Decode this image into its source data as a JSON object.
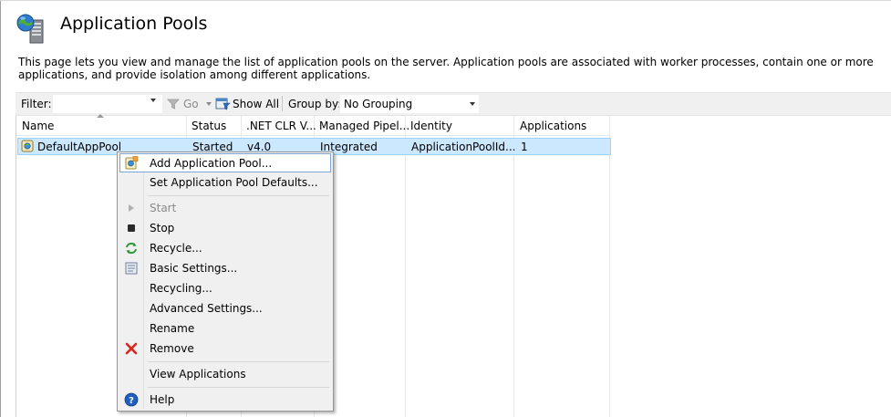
{
  "page": {
    "title": "Application Pools",
    "description": "This page lets you view and manage the list of application pools on the server. Application pools are associated with worker processes, contain one or more applications, and provide isolation among different applications."
  },
  "toolbar": {
    "filter_label": "Filter:",
    "filter_value": "",
    "go_label": "Go",
    "show_all_label": "Show All",
    "group_by_label": "Group by:",
    "group_by_value": "No Grouping"
  },
  "grid": {
    "columns": [
      "Name",
      "Status",
      ".NET CLR V...",
      "Managed Pipel...",
      "Identity",
      "Applications"
    ],
    "rows": [
      {
        "name": "DefaultAppPool",
        "status": "Started",
        "clr": "v4.0",
        "pipeline": "Integrated",
        "identity": "ApplicationPoolId...",
        "applications": "1"
      }
    ]
  },
  "context_menu": {
    "items": [
      {
        "label": "Add Application Pool...",
        "icon": "add-pool-icon",
        "highlighted": true
      },
      {
        "label": "Set Application Pool Defaults...",
        "icon": ""
      },
      {
        "label": "Start",
        "icon": "play-icon",
        "disabled": true
      },
      {
        "label": "Stop",
        "icon": "stop-icon"
      },
      {
        "label": "Recycle...",
        "icon": "recycle-icon"
      },
      {
        "label": "Basic Settings...",
        "icon": "settings-icon"
      },
      {
        "label": "Recycling...",
        "icon": ""
      },
      {
        "label": "Advanced Settings...",
        "icon": ""
      },
      {
        "label": "Rename",
        "icon": ""
      },
      {
        "label": "Remove",
        "icon": "remove-icon"
      },
      {
        "label": "View Applications",
        "icon": ""
      },
      {
        "label": "Help",
        "icon": "help-icon"
      }
    ]
  },
  "colors": {
    "selection_fill": "#cce8ff",
    "selection_border": "#99d1ff",
    "remove_red": "#d9251c",
    "help_blue": "#1f5fbf"
  }
}
